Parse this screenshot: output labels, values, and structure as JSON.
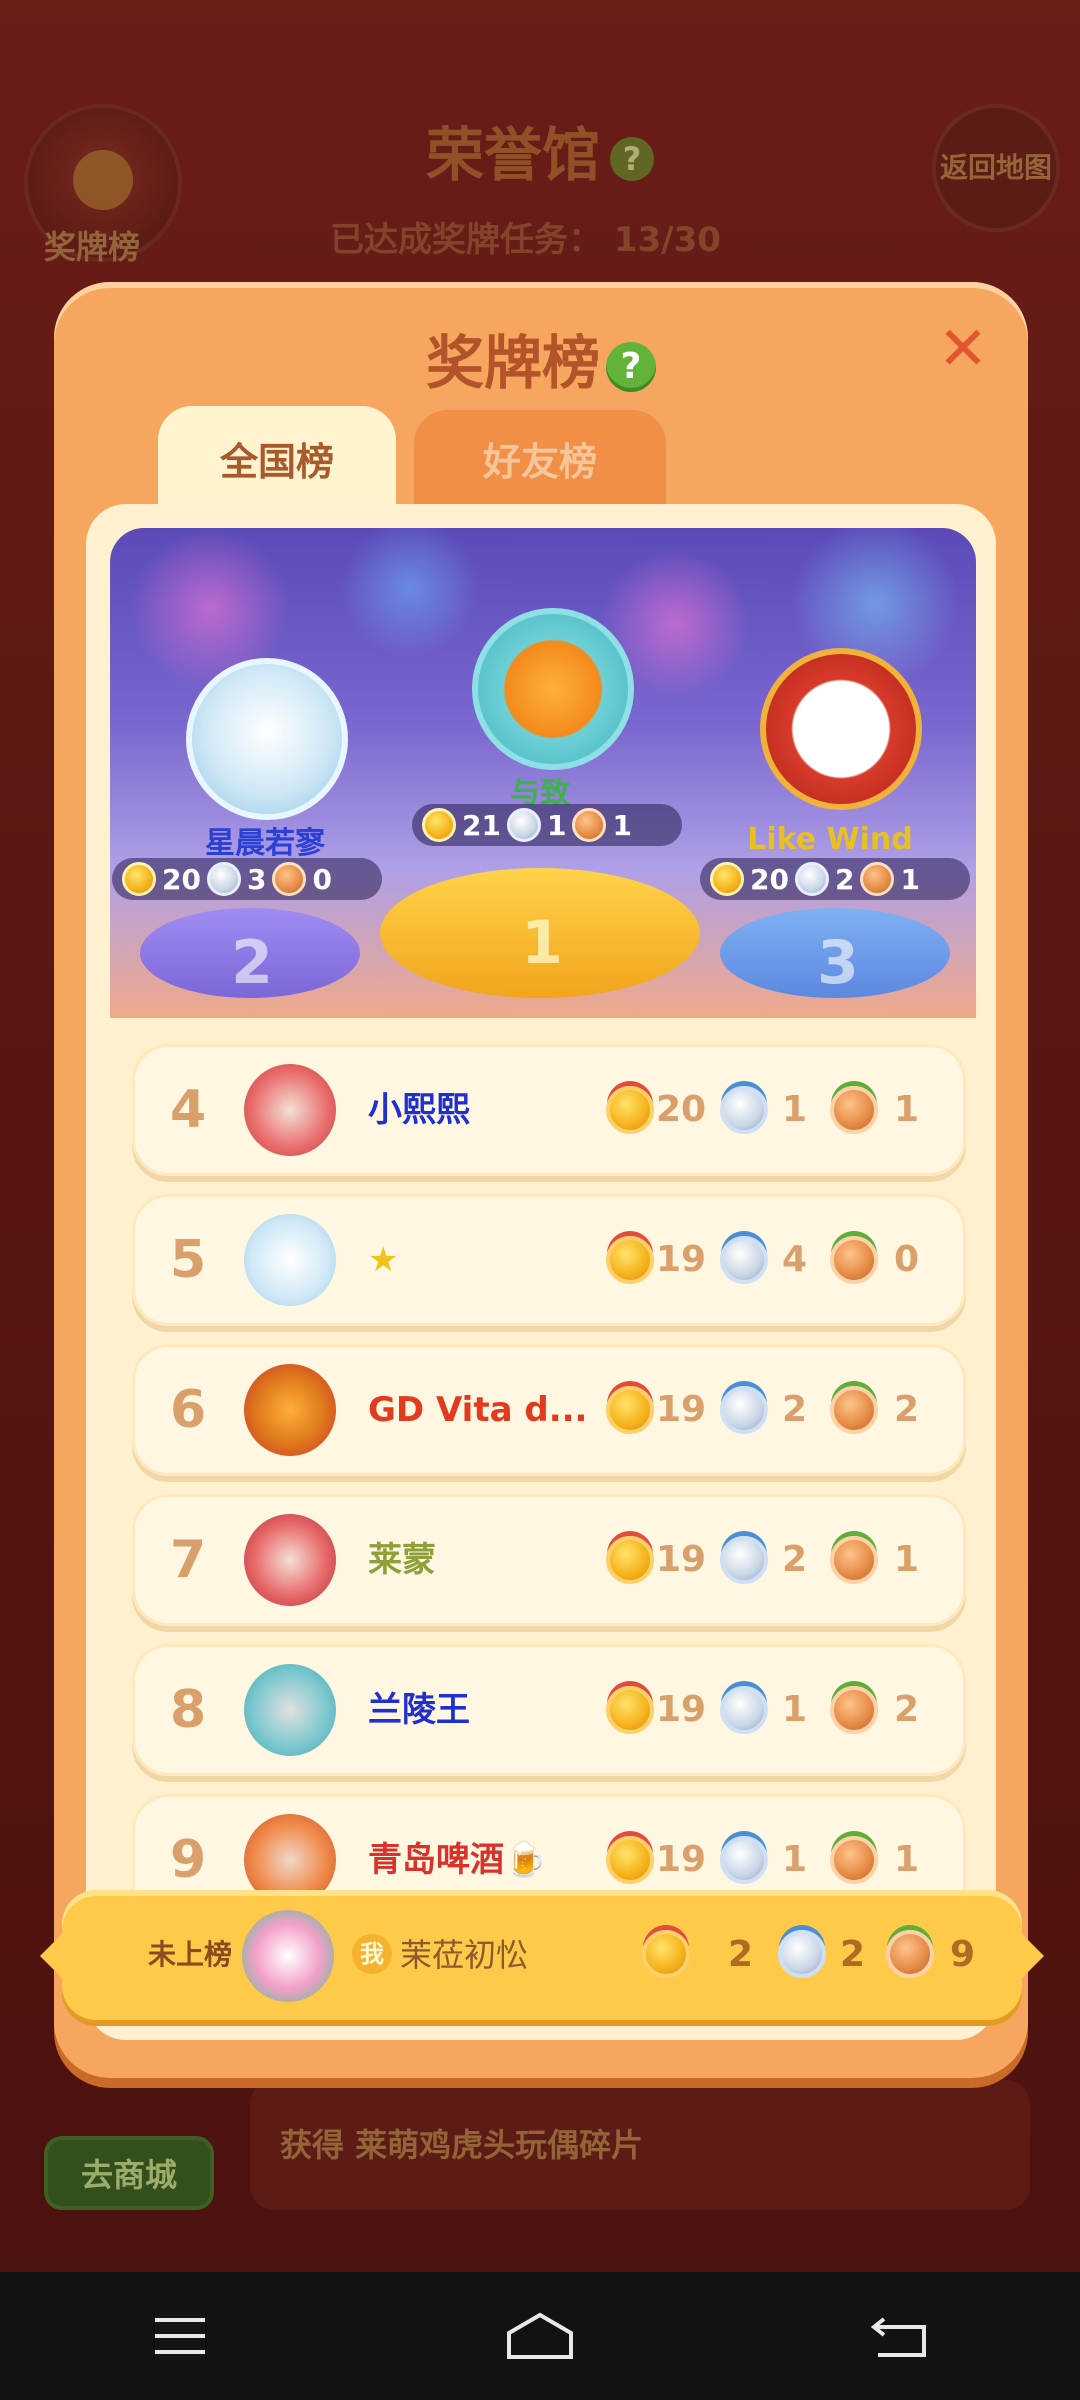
{
  "background": {
    "title": "荣誉馆",
    "progress_label": "已达成奖牌任务：",
    "progress_value": "13/30",
    "badge_button_label": "奖牌榜",
    "return_button_label": "返回地图",
    "shop_button_label": "去商城",
    "reward_text": "获得 莱萌鸡虎头玩偶碎片"
  },
  "modal": {
    "title": "奖牌榜",
    "close_symbol": "✕",
    "tabs": [
      {
        "label": "全国榜",
        "active": true
      },
      {
        "label": "好友榜",
        "active": false
      }
    ]
  },
  "podium": [
    {
      "rank": "1",
      "name": "与致",
      "gold": "21",
      "silver": "1",
      "bronze": "1",
      "name_color": "#3cb34a"
    },
    {
      "rank": "2",
      "name": "星晨若寥",
      "gold": "20",
      "silver": "3",
      "bronze": "0",
      "name_color": "#2a3fd6"
    },
    {
      "rank": "3",
      "name": "Like  Wind",
      "gold": "20",
      "silver": "2",
      "bronze": "1",
      "name_color": "#e8c020"
    }
  ],
  "rankings": [
    {
      "rank": "4",
      "name": "小熙熙",
      "gold": "20",
      "silver": "1",
      "bronze": "1",
      "name_color": "#1f2fd0"
    },
    {
      "rank": "5",
      "name": "★",
      "gold": "19",
      "silver": "4",
      "bronze": "0",
      "name_color": "#f2c21a"
    },
    {
      "rank": "6",
      "name": "GD Vita d...",
      "gold": "19",
      "silver": "2",
      "bronze": "2",
      "name_color": "#e23a1e"
    },
    {
      "rank": "7",
      "name": "莱蒙",
      "gold": "19",
      "silver": "2",
      "bronze": "1",
      "name_color": "#8fa03a"
    },
    {
      "rank": "8",
      "name": "兰陵王",
      "gold": "19",
      "silver": "1",
      "bronze": "2",
      "name_color": "#1f2fd0"
    },
    {
      "rank": "9",
      "name": "青岛啤酒🍺",
      "gold": "19",
      "silver": "1",
      "bronze": "1",
      "name_color": "#d8322a"
    }
  ],
  "my_rank": {
    "label": "未上榜",
    "me_tag": "我",
    "name": "茉莅初忪",
    "gold": "2",
    "silver": "2",
    "bronze": "9"
  },
  "icons": {
    "help": "question-mark-icon",
    "close": "close-icon",
    "gold": "gold-medal-icon",
    "silver": "silver-medal-icon",
    "bronze": "bronze-medal-icon"
  },
  "colors": {
    "modal_bg": "#f6a65f",
    "panel_bg": "#fff0cf",
    "row_bg": "#fff7e2",
    "my_bar_bg": "#ffca4a"
  }
}
